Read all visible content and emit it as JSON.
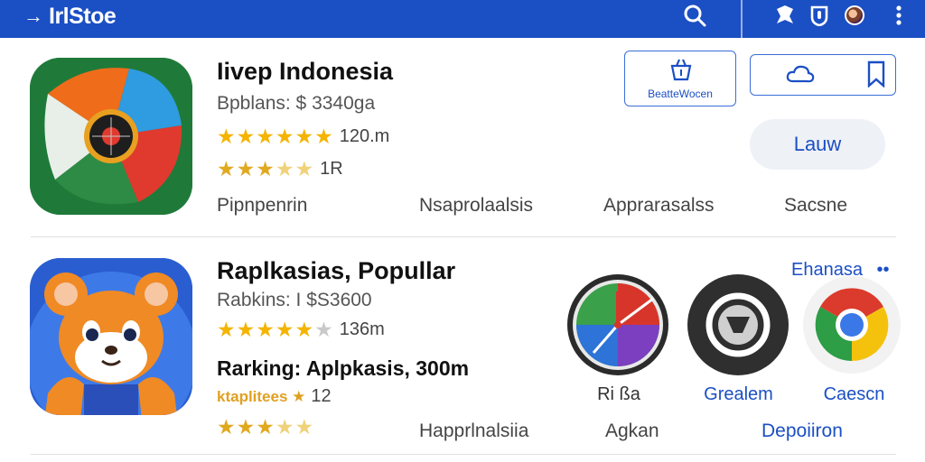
{
  "topbar": {
    "brand": "IrlStoe",
    "icons": [
      "search-icon",
      "pin-icon",
      "shield-icon",
      "avatar",
      "more-vert-icon"
    ],
    "color": "#1b4fc4"
  },
  "featured_app": {
    "title": "Iivep Indonesia",
    "subtitle": "Bpblans: $ 3340ga",
    "rating_count": "120.m",
    "secondary_rating_count": "1R",
    "categories": [
      "Pipnpenrin",
      "Nsaprolaalsis",
      "Apprarasalss",
      "Sacsne"
    ],
    "action_button_label": "BeatteWocen",
    "primary_button_label": "Lauw"
  },
  "popular_app": {
    "title": "Raplkasias, Popullar",
    "subtitle": "Rabkins: I $S3600",
    "rating_count": "136m",
    "ranking_text": "Rarking: Aplpkasis, 300m",
    "ranking_sub_label": "ktaplitees ★",
    "ranking_sub_count": "12",
    "categories": [
      "Happrlnalsiia",
      "Agkan",
      "Depoiiron"
    ]
  },
  "related_apps": {
    "header_link": "Ehanasa",
    "header_link_suffix": "••",
    "apps": [
      {
        "label": "Ri ßa"
      },
      {
        "label": "Grealem"
      },
      {
        "label": "Caescn"
      }
    ]
  }
}
